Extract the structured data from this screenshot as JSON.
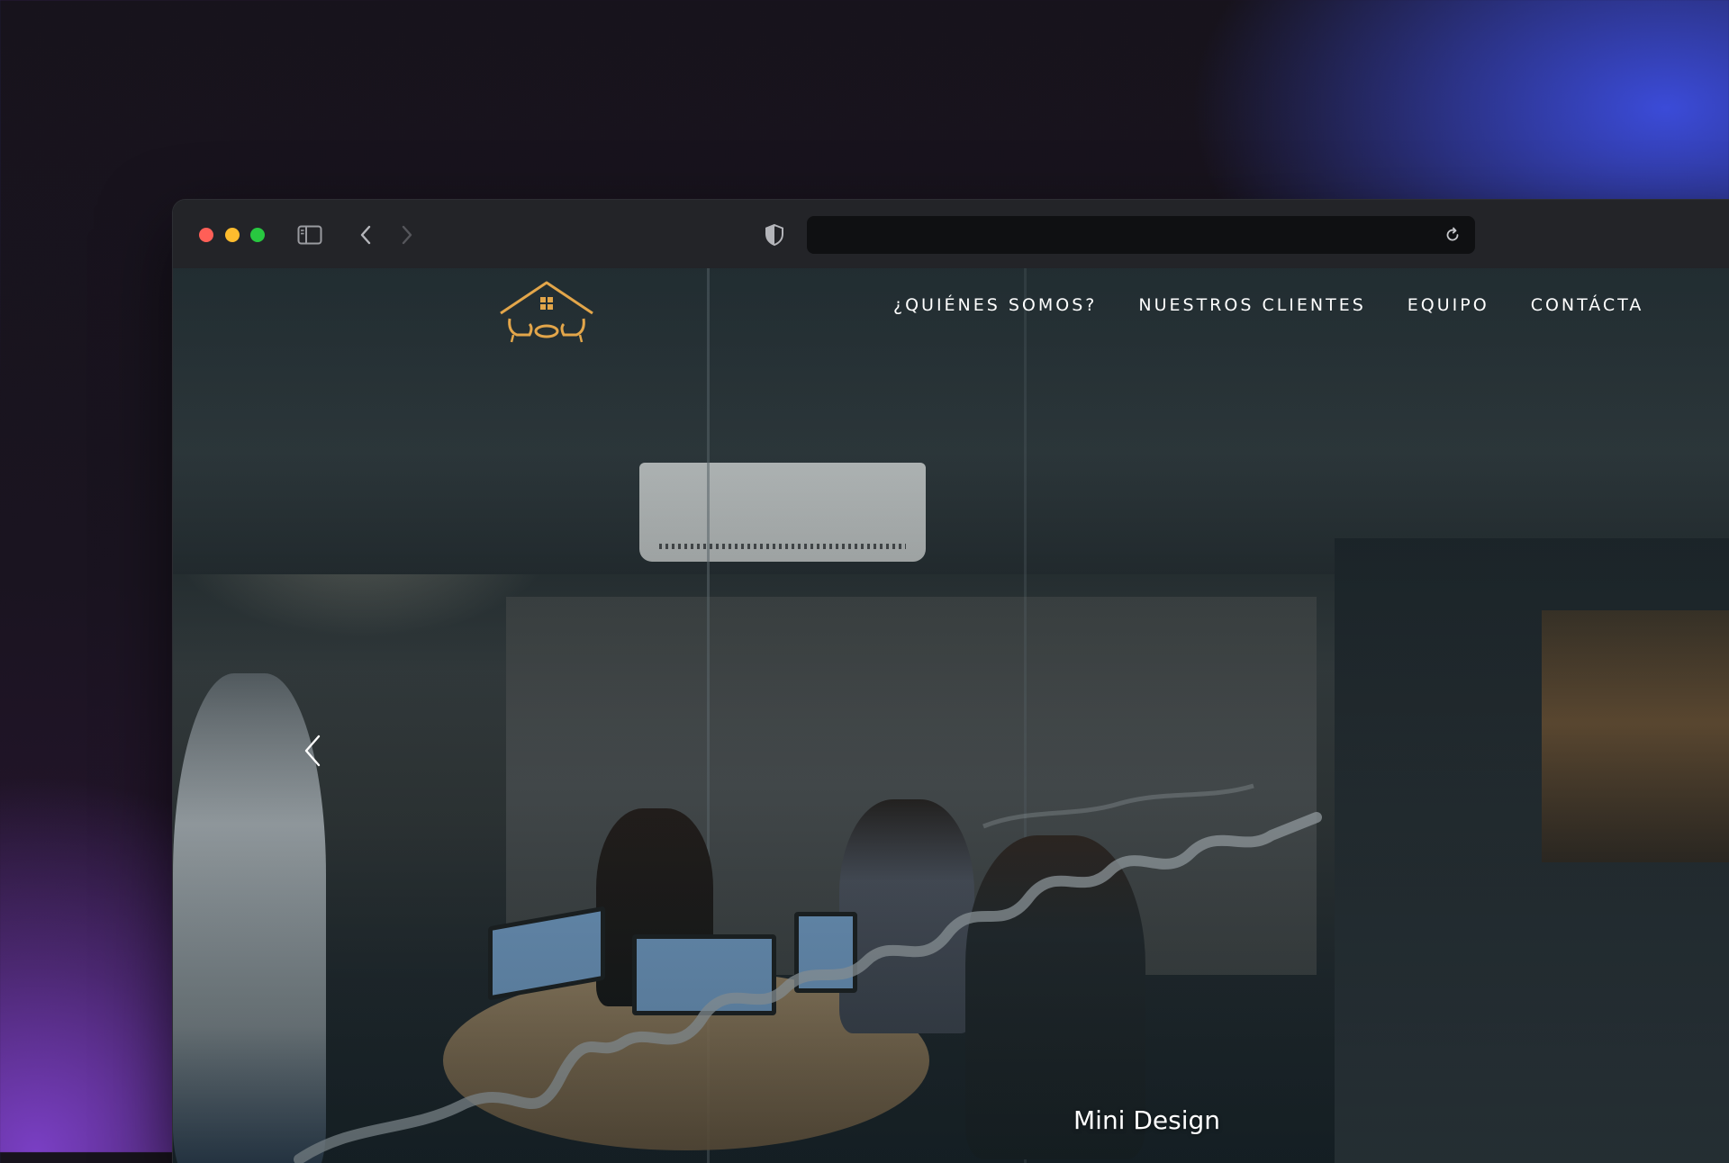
{
  "browser": {
    "traffic_lights": [
      "close",
      "minimize",
      "zoom"
    ],
    "icons": {
      "sidebar": "sidebar-icon",
      "back": "chevron-left-icon",
      "forward": "chevron-right-icon",
      "shield": "shield-icon",
      "reload": "reload-icon"
    },
    "address_value": ""
  },
  "site": {
    "logo": "house-with-chairs-logo",
    "nav": [
      {
        "label": "¿QUIÉNES SOMOS?"
      },
      {
        "label": "NUESTROS CLIENTES"
      },
      {
        "label": "EQUIPO"
      },
      {
        "label": "CONTÁCTA"
      }
    ],
    "hero": {
      "prev_icon": "chevron-left-icon",
      "caption": "Mini Design"
    }
  },
  "colors": {
    "logo_gold": "#e3a64a",
    "close": "#ff5f57",
    "minimize": "#febc2e",
    "zoom": "#28c840"
  }
}
